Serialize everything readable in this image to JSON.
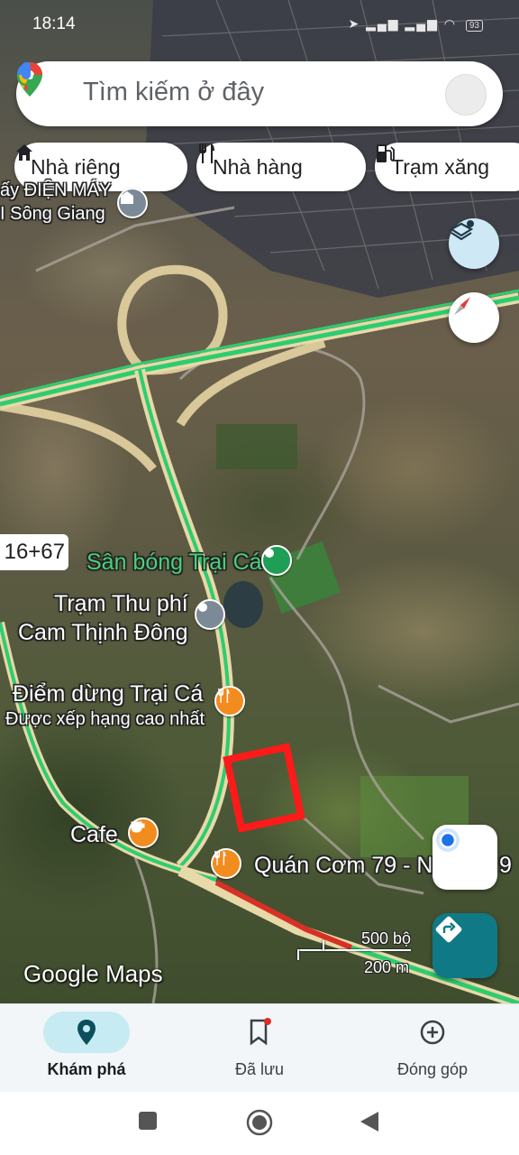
{
  "status_bar": {
    "time": "18:14",
    "battery": "93"
  },
  "search": {
    "placeholder": "Tìm kiếm ở đây"
  },
  "chips": [
    {
      "label": "Nhà riêng",
      "icon": "home-icon"
    },
    {
      "label": "Nhà hàng",
      "icon": "restaurant-icon"
    },
    {
      "label": "Trạm xăng",
      "icon": "gas-station-icon"
    }
  ],
  "map": {
    "labels": {
      "store_line1": "ấy ĐIỆN MÁY",
      "store_line2": "I Sông Giang",
      "road_number": "16+67",
      "stadium": "Sân bóng Trại Cá",
      "toll_line1": "Trạm Thu phí",
      "toll_line2": "Cam Thịnh Đông",
      "stop_name": "Điểm dừng Trại Cá",
      "stop_rating": "Được xếp hạng cao nhất",
      "cafe": "Cafe",
      "restaurant": "Quán Cơm 79 - N",
      "restaurant_tail": "9"
    },
    "scale": {
      "imperial": "500 bộ",
      "metric": "200 m"
    },
    "attribution": "Google Maps"
  },
  "bottom_nav": [
    {
      "label": "Khám phá",
      "icon": "explore-pin-icon",
      "active": true
    },
    {
      "label": "Đã lưu",
      "icon": "bookmark-icon",
      "active": false
    },
    {
      "label": "Đóng góp",
      "icon": "add-circle-icon",
      "active": false
    }
  ],
  "colors": {
    "accent": "#1a73e8",
    "traffic_green": "#2ecc71",
    "traffic_red": "#d93025",
    "poi_orange": "#f28c1e",
    "poi_green": "#1e9e57",
    "poi_gray": "#7b8a96",
    "nav_active": "#c7ebf2",
    "directions": "#0f7a86"
  }
}
